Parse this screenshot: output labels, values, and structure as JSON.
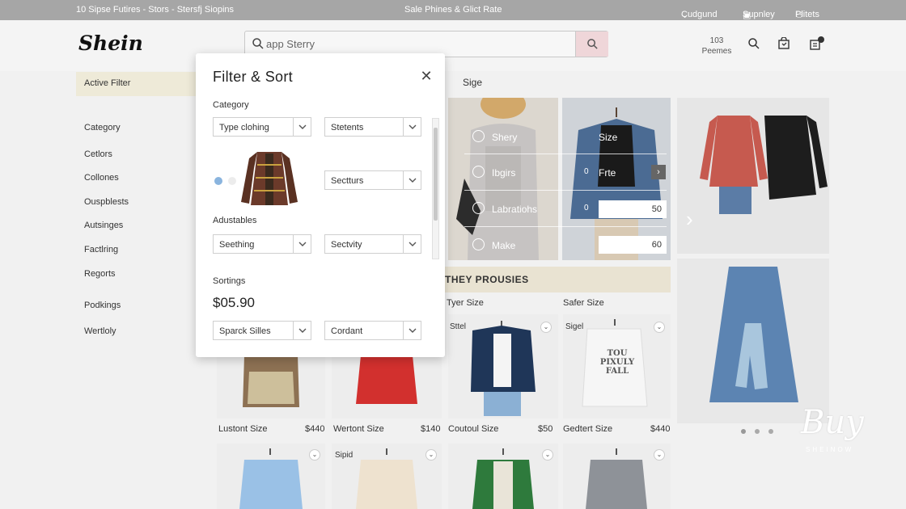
{
  "topbar": {
    "left_text": "10 Sipse Futires - Stors - Stersfj Siopins",
    "center_text": "Sale Phines  & Glict Rate",
    "dropdown_label": "Cudgund",
    "supply_label": "Supnley",
    "pilots_label": "Plitets"
  },
  "header": {
    "logo": "Shein",
    "search_value": "app Sterry",
    "count_value": "103",
    "count_label": "Peemes"
  },
  "sidebar": {
    "active_filter": "Active Filter",
    "items": [
      "Category",
      "Cetlors",
      "Collones",
      "Ouspblests",
      "Autsinges",
      "Factlring",
      "Regorts",
      "Podkings",
      "Wertloly"
    ]
  },
  "modal": {
    "title": "Filter & Sort",
    "category_label": "Category",
    "dd_type": "Type clohing",
    "dd_statents": "Stetents",
    "dd_sectturs": "Sectturs",
    "adjustables_label": "Adustables",
    "dd_seething": "Seething",
    "dd_sectivity": "Sectvity",
    "sortings_label": "Sortings",
    "price": "$05.90",
    "dd_sparck": "Sparck Silles",
    "dd_cordant": "Cordant"
  },
  "products": {
    "size_heading": "Sige",
    "hero_filters": {
      "options": [
        "Shery",
        "Ibgirs",
        "Labratiohs",
        "Make"
      ],
      "size_title": "Size",
      "fre_label": "Frte",
      "input_50": "50",
      "input_60": "60",
      "num_0a": "0",
      "num_0b": "0"
    },
    "banner": "THEY PROUSIES",
    "sub_left": "Tyer Size",
    "sub_right": "Safer Size",
    "row1": [
      {
        "name": "Lustont Size",
        "price": "$440"
      },
      {
        "name": "Wertont Size",
        "price": "$140"
      },
      {
        "name": "Coutoul Size",
        "price": "$50"
      },
      {
        "name": "Gedtert Size",
        "price": "$440"
      }
    ],
    "tag_sttel": "Sttel",
    "tag_sigel": "Sigel",
    "tag_sipid": "Sipid",
    "shirt_print": "TOU PIXULY FALL"
  },
  "watermark": {
    "main": "Buy",
    "sub": "SHEINOW"
  },
  "colors": {
    "accent": "#efd6d9",
    "active_filter_bg": "#eeead8",
    "banner_bg": "#e9e3d2"
  }
}
